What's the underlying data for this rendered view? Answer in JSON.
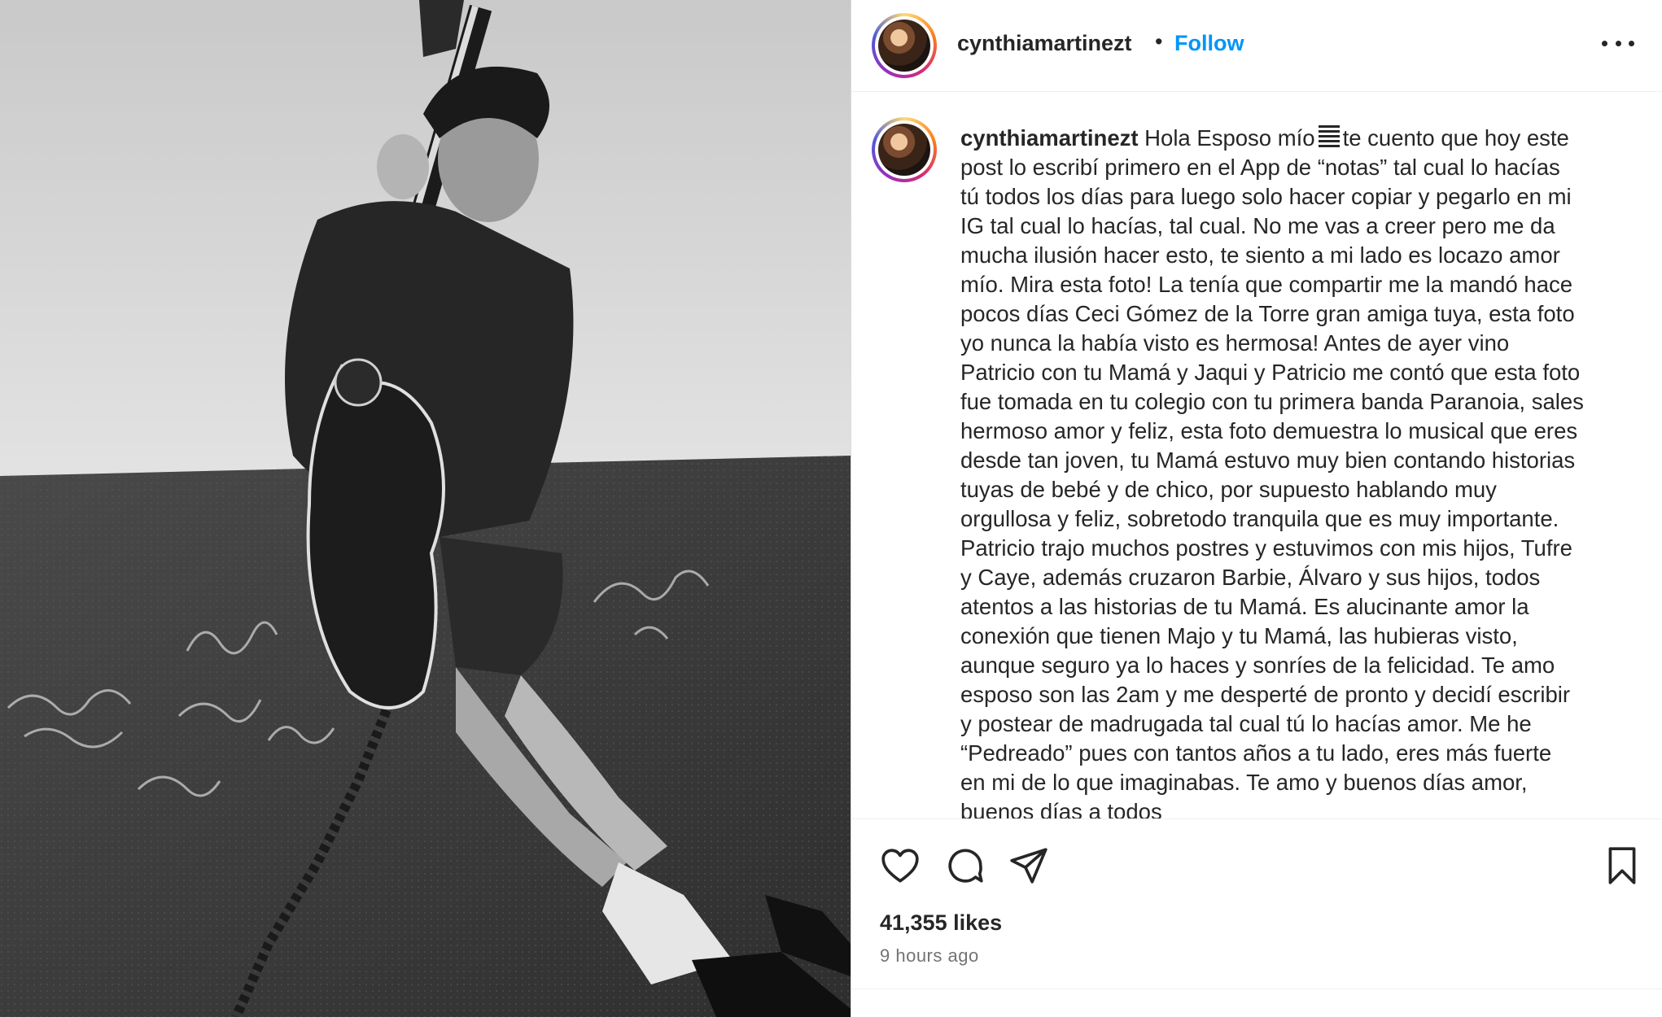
{
  "post": {
    "username": "cynthiamartinezt",
    "separator": "•",
    "follow_label": "Follow",
    "more_icon": "more-options-icon"
  },
  "caption": {
    "username": "cynthiamartinezt",
    "lines": [
      "Hola Esposo mío",
      "te cuento que hoy este",
      "post lo escribí primero en el App de “notas” tal cual lo hacías",
      "tú todos los días para luego solo hacer copiar y pegarlo en mi",
      "IG tal cual lo hacías, tal cual. No me vas a creer pero me da",
      "mucha ilusión hacer esto, te siento a mi lado es locazo amor",
      "mío. Mira esta foto! La tenía que compartir me la mandó hace",
      "pocos días Ceci Gómez de la Torre gran amiga tuya, esta foto",
      "yo nunca la había visto es hermosa! Antes de ayer vino",
      "Patricio con tu Mamá y Jaqui y Patricio me contó que esta foto",
      "fue tomada en tu colegio con tu primera banda Paranoia, sales",
      "hermoso amor y feliz, esta foto demuestra lo musical que eres",
      "desde tan joven, tu Mamá estuvo muy bien contando historias",
      "tuyas de bebé y de chico, por supuesto hablando muy",
      "orgullosa y feliz, sobretodo tranquila que es muy importante.",
      "Patricio trajo muchos postres y estuvimos con mis hijos, Tufre",
      "y Caye, además cruzaron Barbie, Álvaro y sus hijos, todos",
      "atentos a las historias de tu Mamá. Es alucinante amor la",
      "conexión que tienen Majo y tu Mamá, las hubieras visto,",
      "aunque seguro ya lo haces y sonríes de la felicidad. Te amo",
      "esposo son las 2am y me desperté de pronto y decidí escribir",
      "y postear de madrugada tal cual tú lo hacías amor. Me he",
      "“Pedreado” pues con tantos años a tu lado, eres más fuerte",
      "en mi de lo que imaginabas. Te amo y buenos días amor,",
      "buenos días a todos"
    ]
  },
  "actions": {
    "like_icon": "heart-icon",
    "comment_icon": "comment-icon",
    "share_icon": "share-icon",
    "save_icon": "bookmark-icon",
    "likes": "41,355 likes",
    "time": "9 hours ago"
  },
  "colors": {
    "link_blue": "#0095f6",
    "text": "#262626",
    "muted": "#737373",
    "border": "#efefef"
  }
}
